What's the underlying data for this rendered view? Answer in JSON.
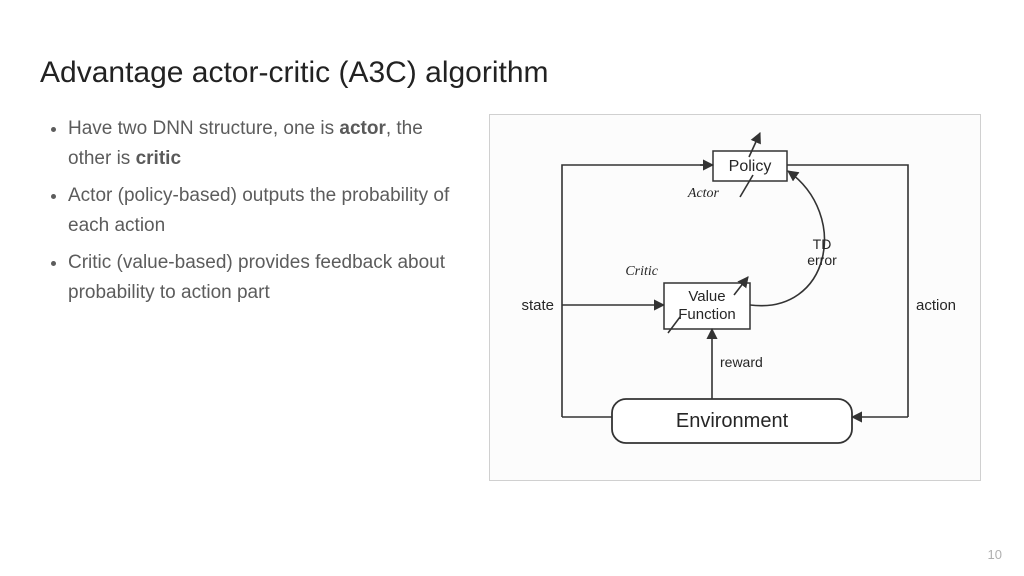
{
  "title": "Advantage actor-critic (A3C) algorithm",
  "bullets": [
    {
      "pre": "Have two DNN structure, one is ",
      "b1": "actor",
      "mid": ", the other is ",
      "b2": "critic",
      "post": ""
    },
    {
      "text": "Actor (policy-based) outputs the probability of each action"
    },
    {
      "text": "Critic (value-based) provides feedback about probability to action part"
    }
  ],
  "diagram": {
    "policy": "Policy",
    "value_function_l1": "Value",
    "value_function_l2": "Function",
    "environment": "Environment",
    "actor": "Actor",
    "critic": "Critic",
    "td_error_l1": "TD",
    "td_error_l2": "error",
    "state": "state",
    "action": "action",
    "reward": "reward"
  },
  "page_number": "10"
}
